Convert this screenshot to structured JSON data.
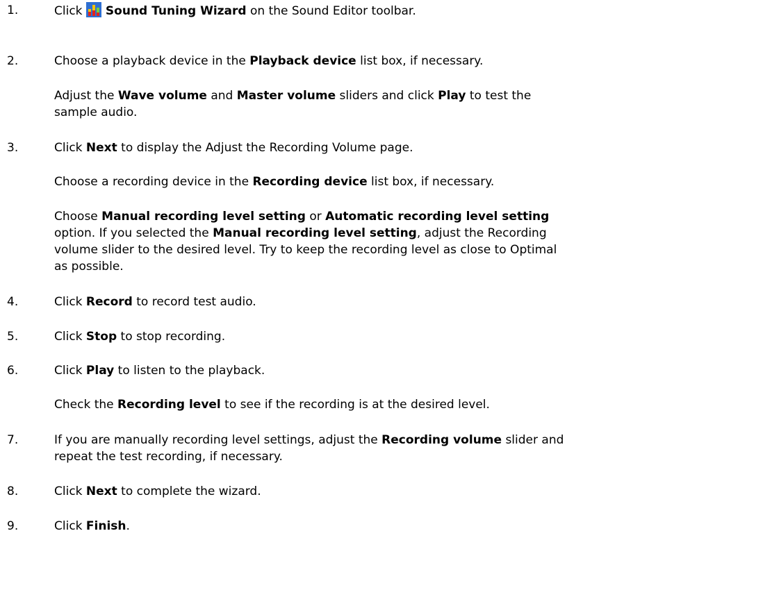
{
  "steps": [
    {
      "num": "1.",
      "pre": "Click ",
      "icon": "sound-tuning-wizard-icon",
      "bold": "Sound Tuning Wizard",
      "post": " on the Sound Editor toolbar."
    },
    {
      "num": "2.",
      "pre": "Choose a playback device in the ",
      "bold": "Playback device",
      "post": " list box, if necessary."
    },
    {
      "num": "3.",
      "pre": "Click ",
      "bold": "Next",
      "post": " to display the Adjust the Recording Volume page."
    },
    {
      "num": "4.",
      "pre": "Click ",
      "bold": "Record",
      "post": " to record test audio."
    },
    {
      "num": "5.",
      "pre": "Click ",
      "bold": "Stop",
      "post": " to stop recording."
    },
    {
      "num": "6.",
      "pre": "Click ",
      "bold": "Play",
      "post": " to listen to the playback."
    },
    {
      "num": "7.",
      "pre": "If you are manually recording level settings, adjust the ",
      "bold": "Recording volume",
      "post": " slider and",
      "line2": "repeat the test recording, if necessary."
    },
    {
      "num": "8.",
      "pre": "Click ",
      "bold": "Next",
      "post": " to complete the wizard."
    },
    {
      "num": "9.",
      "pre": "Click ",
      "bold": "Finish",
      "post": "."
    }
  ],
  "notes": {
    "step2": {
      "a": "Adjust the ",
      "b1": "Wave volume",
      "c": " and ",
      "b2": "Master volume",
      "d": " sliders and click ",
      "b3": "Play",
      "e": " to test the",
      "line2": "sample audio."
    },
    "step3a": {
      "a": "Choose a recording device in the ",
      "b1": "Recording device",
      "c": " list box, if necessary."
    },
    "step3b": {
      "a": "Choose ",
      "b1": "Manual recording level setting",
      "c": " or ",
      "b2": "Automatic recording level setting",
      "d": "option. If you selected the ",
      "b3": "Manual recording level setting",
      "e": ", adjust the Recording",
      "f": "volume slider to the desired level. Try to keep the recording level as close to Optimal",
      "g": "as possible."
    },
    "step6": {
      "a": "Check the ",
      "b1": "Recording level",
      "c": " to see if the recording is at the desired level."
    }
  }
}
